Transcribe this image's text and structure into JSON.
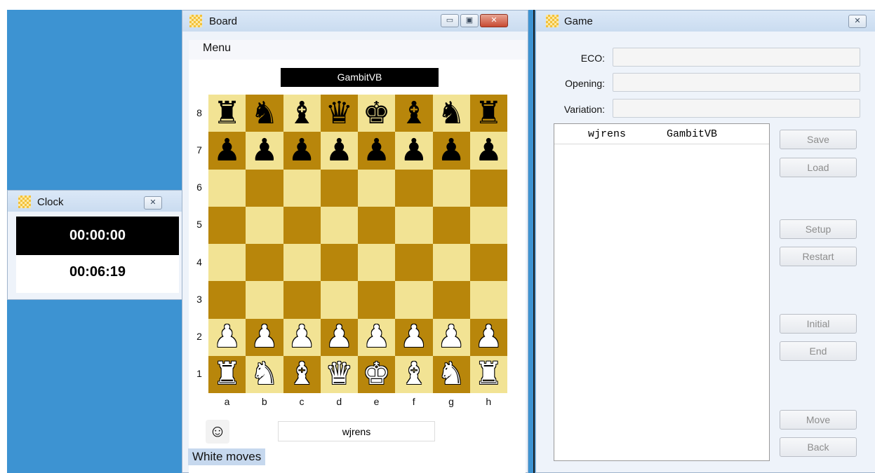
{
  "clock": {
    "title": "Clock",
    "close_label": "✕",
    "top_time": "00:00:00",
    "bottom_time": "00:06:19"
  },
  "board_window": {
    "title": "Board",
    "minimize_label": "▭",
    "maximize_label": "▣",
    "close_label": "✕",
    "menu": "Menu",
    "top_player": "GambitVB",
    "bottom_player": "wjrens",
    "status": "White moves",
    "smiley": "☺",
    "ranks": [
      "8",
      "7",
      "6",
      "5",
      "4",
      "3",
      "2",
      "1"
    ],
    "files": [
      "a",
      "b",
      "c",
      "d",
      "e",
      "f",
      "g",
      "h"
    ],
    "position": [
      [
        "br",
        "bn",
        "bb",
        "bq",
        "bk",
        "bb",
        "bn",
        "br"
      ],
      [
        "bp",
        "bp",
        "bp",
        "bp",
        "bp",
        "bp",
        "bp",
        "bp"
      ],
      [
        "",
        "",
        "",
        "",
        "",
        "",
        "",
        ""
      ],
      [
        "",
        "",
        "",
        "",
        "",
        "",
        "",
        ""
      ],
      [
        "",
        "",
        "",
        "",
        "",
        "",
        "",
        ""
      ],
      [
        "",
        "",
        "",
        "",
        "",
        "",
        "",
        ""
      ],
      [
        "wp",
        "wp",
        "wp",
        "wp",
        "wp",
        "wp",
        "wp",
        "wp"
      ],
      [
        "wr",
        "wn",
        "wb",
        "wq",
        "wk",
        "wb",
        "wn",
        "wr"
      ]
    ],
    "colors": {
      "light_square": "#f2e394",
      "dark_square": "#b8860b"
    }
  },
  "game_window": {
    "title": "Game",
    "close_label": "✕",
    "eco_label": "ECO:",
    "opening_label": "Opening:",
    "variation_label": "Variation:",
    "eco_value": "",
    "opening_value": "",
    "variation_value": "",
    "moves_header_white": "wjrens",
    "moves_header_black": "GambitVB",
    "buttons": {
      "save": "Save",
      "load": "Load",
      "setup": "Setup",
      "restart": "Restart",
      "initial": "Initial",
      "end": "End",
      "move": "Move",
      "back": "Back"
    }
  }
}
